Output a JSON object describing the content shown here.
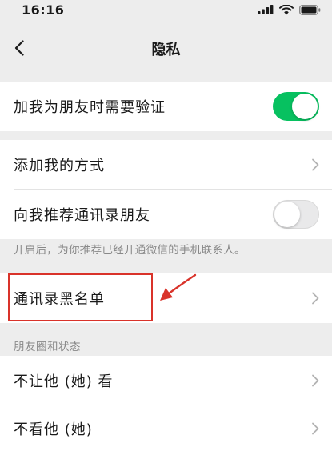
{
  "status_bar": {
    "time": "16:16",
    "icons": [
      "signal-icon",
      "wifi-icon",
      "battery-icon"
    ]
  },
  "nav": {
    "title": "隐私",
    "back_icon": "chevron-left-icon"
  },
  "rows": {
    "verify_friend": {
      "label": "加我为朋友时需要验证",
      "toggle_on": true
    },
    "add_me_methods": {
      "label": "添加我的方式"
    },
    "recommend_contacts": {
      "label": "向我推荐通讯录朋友",
      "toggle_on": false
    },
    "blacklist": {
      "label": "通讯录黑名单"
    },
    "hide_from": {
      "label": "不让他 (她) 看"
    },
    "dont_see": {
      "label": "不看他 (她)"
    }
  },
  "hint_text": "开启后，为你推荐已经开通微信的手机联系人。",
  "section_moments": "朋友圈和状态",
  "colors": {
    "accent": "#07c160",
    "annotation": "#d9332a",
    "background": "#ededed"
  }
}
